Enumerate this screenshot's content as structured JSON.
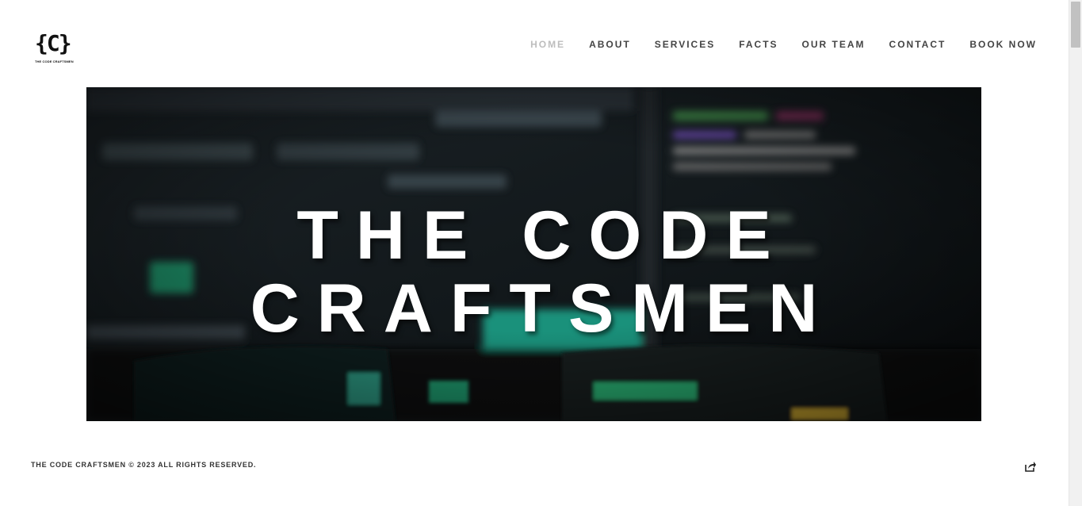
{
  "brand": {
    "logo_mark": "{C}",
    "logo_subtext": "THE CODE CRAFTSMEN"
  },
  "nav": {
    "items": [
      {
        "label": "HOME",
        "active": true
      },
      {
        "label": "ABOUT"
      },
      {
        "label": "SERVICES"
      },
      {
        "label": "FACTS"
      },
      {
        "label": "OUR TEAM"
      },
      {
        "label": "CONTACT"
      },
      {
        "label": "BOOK NOW"
      }
    ]
  },
  "hero": {
    "title_line1": "THE CODE",
    "title_line2": "CRAFTSMEN"
  },
  "footer": {
    "copyright": "THE CODE CRAFTSMEN © 2023 ALL RIGHTS RESERVED.",
    "share_icon": "share-icon"
  },
  "colors": {
    "nav_text": "#444444",
    "nav_active": "#bdbdbd",
    "hero_text": "#ffffff",
    "hero_bg": "#0e1316",
    "accent_green": "#2fd0a0"
  }
}
